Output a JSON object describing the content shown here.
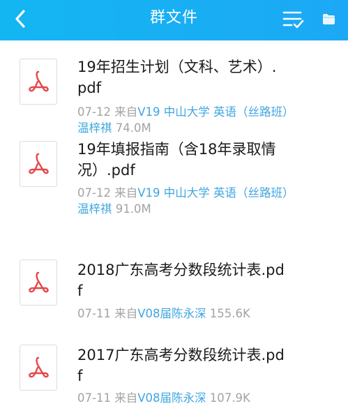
{
  "header": {
    "title": "群文件",
    "accent": "#1ca8f5"
  },
  "icons": {
    "back": "chevron-left-icon",
    "list": "checklist-icon",
    "folder": "folder-icon",
    "file": "pdf-icon"
  },
  "files": [
    {
      "name": "19年招生计划（文科、艺术）.pdf",
      "date": "07-12",
      "from_label": "来自",
      "source": "V19 中山大学 英语（丝路班）温梓祺",
      "size": "74.0M"
    },
    {
      "name": "19年填报指南（含18年录取情况）.pdf",
      "date": "07-12",
      "from_label": "来自",
      "source": "V19 中山大学 英语（丝路班）温梓祺",
      "size": "91.0M"
    },
    {
      "name": "2018广东高考分数段统计表.pdf",
      "date": "07-11",
      "from_label": "来自",
      "source": "V08届陈永深",
      "size": "155.6K"
    },
    {
      "name": "2017广东高考分数段统计表.pdf",
      "date": "07-11",
      "from_label": "来自",
      "source": "V08届陈永深",
      "size": "107.9K"
    }
  ]
}
